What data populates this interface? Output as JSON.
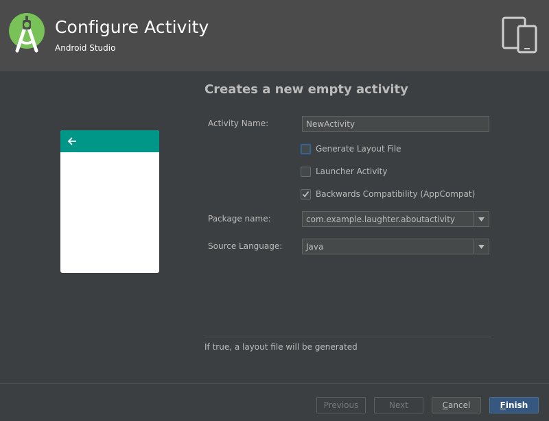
{
  "header": {
    "title": "Configure Activity",
    "subtitle": "Android Studio"
  },
  "section_title": "Creates a new empty activity",
  "form": {
    "activity_name_label": "Activity Name:",
    "activity_name_value": "NewActivity",
    "options": [
      {
        "label": "Generate Layout File",
        "checked": false,
        "focused": true
      },
      {
        "label": "Launcher Activity",
        "checked": false,
        "focused": false
      },
      {
        "label": "Backwards Compatibility (AppCompat)",
        "checked": true,
        "focused": false
      }
    ],
    "package_name_label": "Package name:",
    "package_name_value": "com.example.laughter.aboutactivity",
    "source_language_label": "Source Language:",
    "source_language_value": "Java"
  },
  "hint": "If true, a layout file will be generated",
  "buttons": {
    "previous": "Previous",
    "next": "Next",
    "cancel_mnemonic": "C",
    "cancel_rest": "ancel",
    "finish_mnemonic": "F",
    "finish_rest": "inish"
  },
  "colors": {
    "header_bg": "#4b4b4b",
    "body_bg": "#3c3f41",
    "android_green": "#78c257",
    "toolbar_teal": "#009688",
    "primary_button": "#365880"
  },
  "icons": {
    "logo": "android-studio-logo",
    "devices": "phone-tablet-devices-icon",
    "back": "arrow-left-icon",
    "dropdown": "triangle-down-icon",
    "checkmark": "check-icon"
  }
}
